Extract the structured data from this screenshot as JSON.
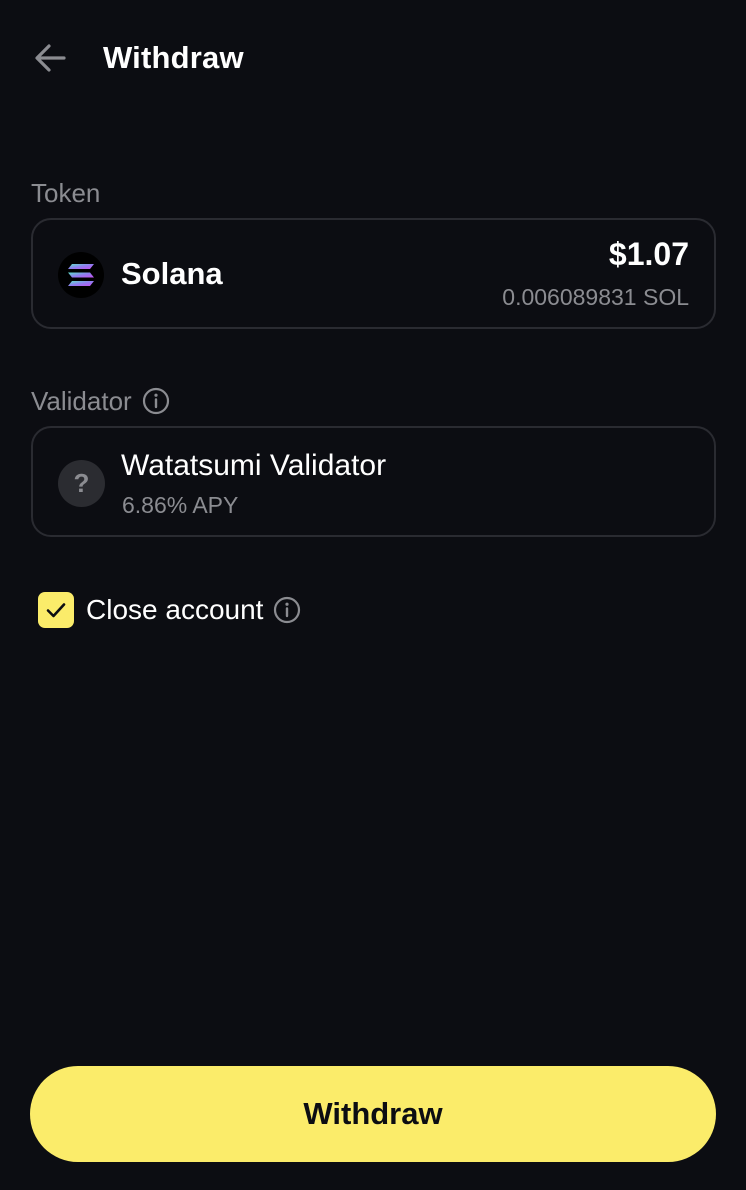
{
  "header": {
    "title": "Withdraw",
    "back_icon": "arrow-left-icon"
  },
  "token": {
    "label": "Token",
    "name": "Solana",
    "usd_value": "$1.07",
    "amount": "0.006089831 SOL",
    "icon": "solana-logo-icon"
  },
  "validator": {
    "label": "Validator",
    "name": "Watatsumi Validator",
    "apy": "6.86% APY",
    "icon": "unknown-validator-icon",
    "placeholder_glyph": "?"
  },
  "close_account": {
    "label": "Close account",
    "checked": true
  },
  "actions": {
    "withdraw_label": "Withdraw"
  },
  "colors": {
    "background": "#0c0d12",
    "accent": "#fbec6a",
    "muted_text": "#8b8c91",
    "card_border": "#2a2b31"
  }
}
